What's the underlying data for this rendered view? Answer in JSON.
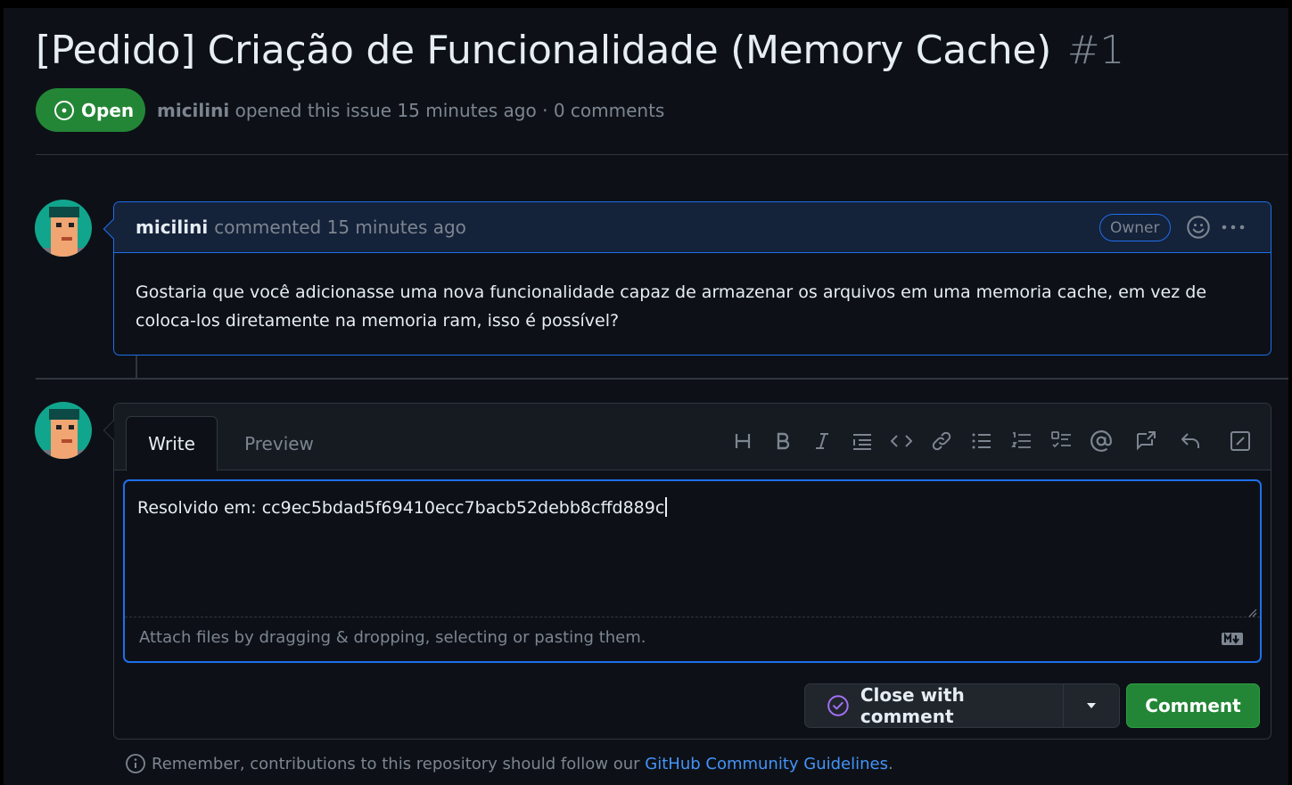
{
  "issue": {
    "title": "[Pedido] Criação de Funcionalidade (Memory Cache)",
    "number": "#1",
    "state": "Open",
    "author": "micilini",
    "meta_text": "opened this issue 15 minutes ago · 0 comments"
  },
  "comment": {
    "author": "micilini",
    "meta": "commented 15 minutes ago",
    "role_badge": "Owner",
    "body_line1": "Gostaria que você adicionasse uma nova funcionalidade capaz de armazenar os arquivos em uma memoria cache, em vez de",
    "body_line2": "coloca-los diretamente na memoria ram, isso é possível?",
    "icons": [
      "smiley-icon",
      "kebab-menu-icon"
    ]
  },
  "editor": {
    "tabs": [
      "Write",
      "Preview"
    ],
    "active_tab": "Write",
    "toolbar_icons": [
      "heading-icon",
      "bold-icon",
      "italic-icon",
      "quote-icon",
      "code-icon",
      "link-icon",
      "unordered-list-icon",
      "ordered-list-icon",
      "task-list-icon",
      "mention-icon",
      "reference-icon",
      "reply-icon",
      "fullscreen-icon"
    ],
    "value": "Resolvido em: cc9ec5bdad5f69410ecc7bacb52debb8cffd889c",
    "attach_hint": "Attach files by dragging & dropping, selecting or pasting them.",
    "close_button": "Close with comment",
    "comment_button": "Comment"
  },
  "footer": {
    "prefix": "Remember, contributions to this repository should follow our",
    "link": "GitHub Community Guidelines",
    "suffix": "."
  },
  "colors": {
    "background": "#0d1117",
    "open_green": "#238636",
    "focus_blue": "#1f6feb",
    "link_blue": "#4493f8",
    "muted": "#7d8590"
  }
}
